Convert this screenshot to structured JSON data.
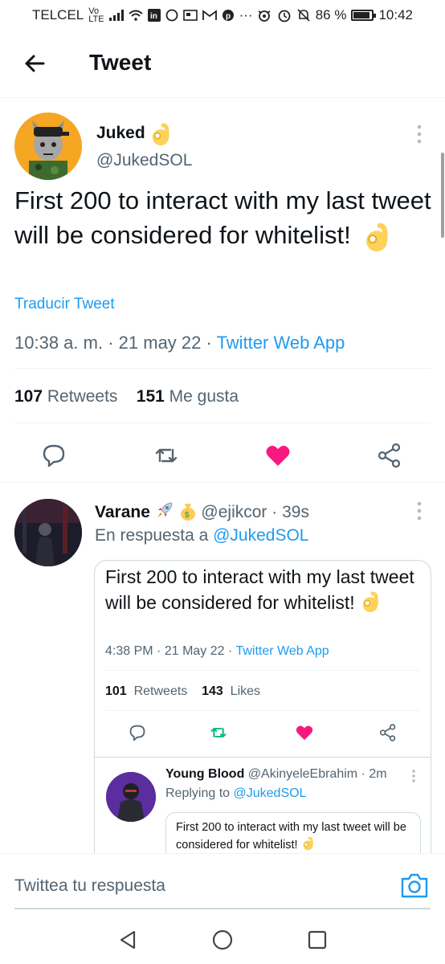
{
  "status_bar": {
    "carrier": "TELCEL",
    "network_top": "Vo",
    "network_bottom": "LTE",
    "battery": "86 %",
    "time": "10:42"
  },
  "header": {
    "title": "Tweet"
  },
  "main_tweet": {
    "author_name": "Juked",
    "author_handle": "@JukedSOL",
    "text": "First 200 to interact with my last tweet will be considered for whitelist!",
    "translate_label": "Traducir Tweet",
    "time": "10:38 a. m.",
    "date": "21 may 22",
    "source": "Twitter Web App",
    "retweets_count": "107",
    "retweets_label": "Retweets",
    "likes_count": "151",
    "likes_label": "Me gusta",
    "liked": true
  },
  "reply": {
    "author_name": "Varane",
    "author_handle": "@ejikcor",
    "age": "39s",
    "replying_prefix": "En respuesta a",
    "replying_handle": "@JukedSOL",
    "quoted": {
      "text": "First 200 to interact with my last tweet will be considered for whitelist!",
      "time": "4:38 PM",
      "date": "21 May 22",
      "source": "Twitter Web App",
      "retweets_count": "101",
      "retweets_label": "Retweets",
      "likes_count": "143",
      "likes_label": "Likes",
      "nested": {
        "author_name": "Young Blood",
        "author_handle": "@AkinyeleEbrahim",
        "age": "2m",
        "replying_prefix": "Replying to",
        "replying_handle": "@JukedSOL",
        "text": "First 200 to interact with my last tweet will be considered for whitelist!"
      }
    }
  },
  "composer": {
    "placeholder": "Twittea tu respuesta"
  },
  "colors": {
    "accent": "#1d9bf0",
    "like": "#f91880",
    "retweet": "#00ba7c",
    "muted": "#536471"
  }
}
